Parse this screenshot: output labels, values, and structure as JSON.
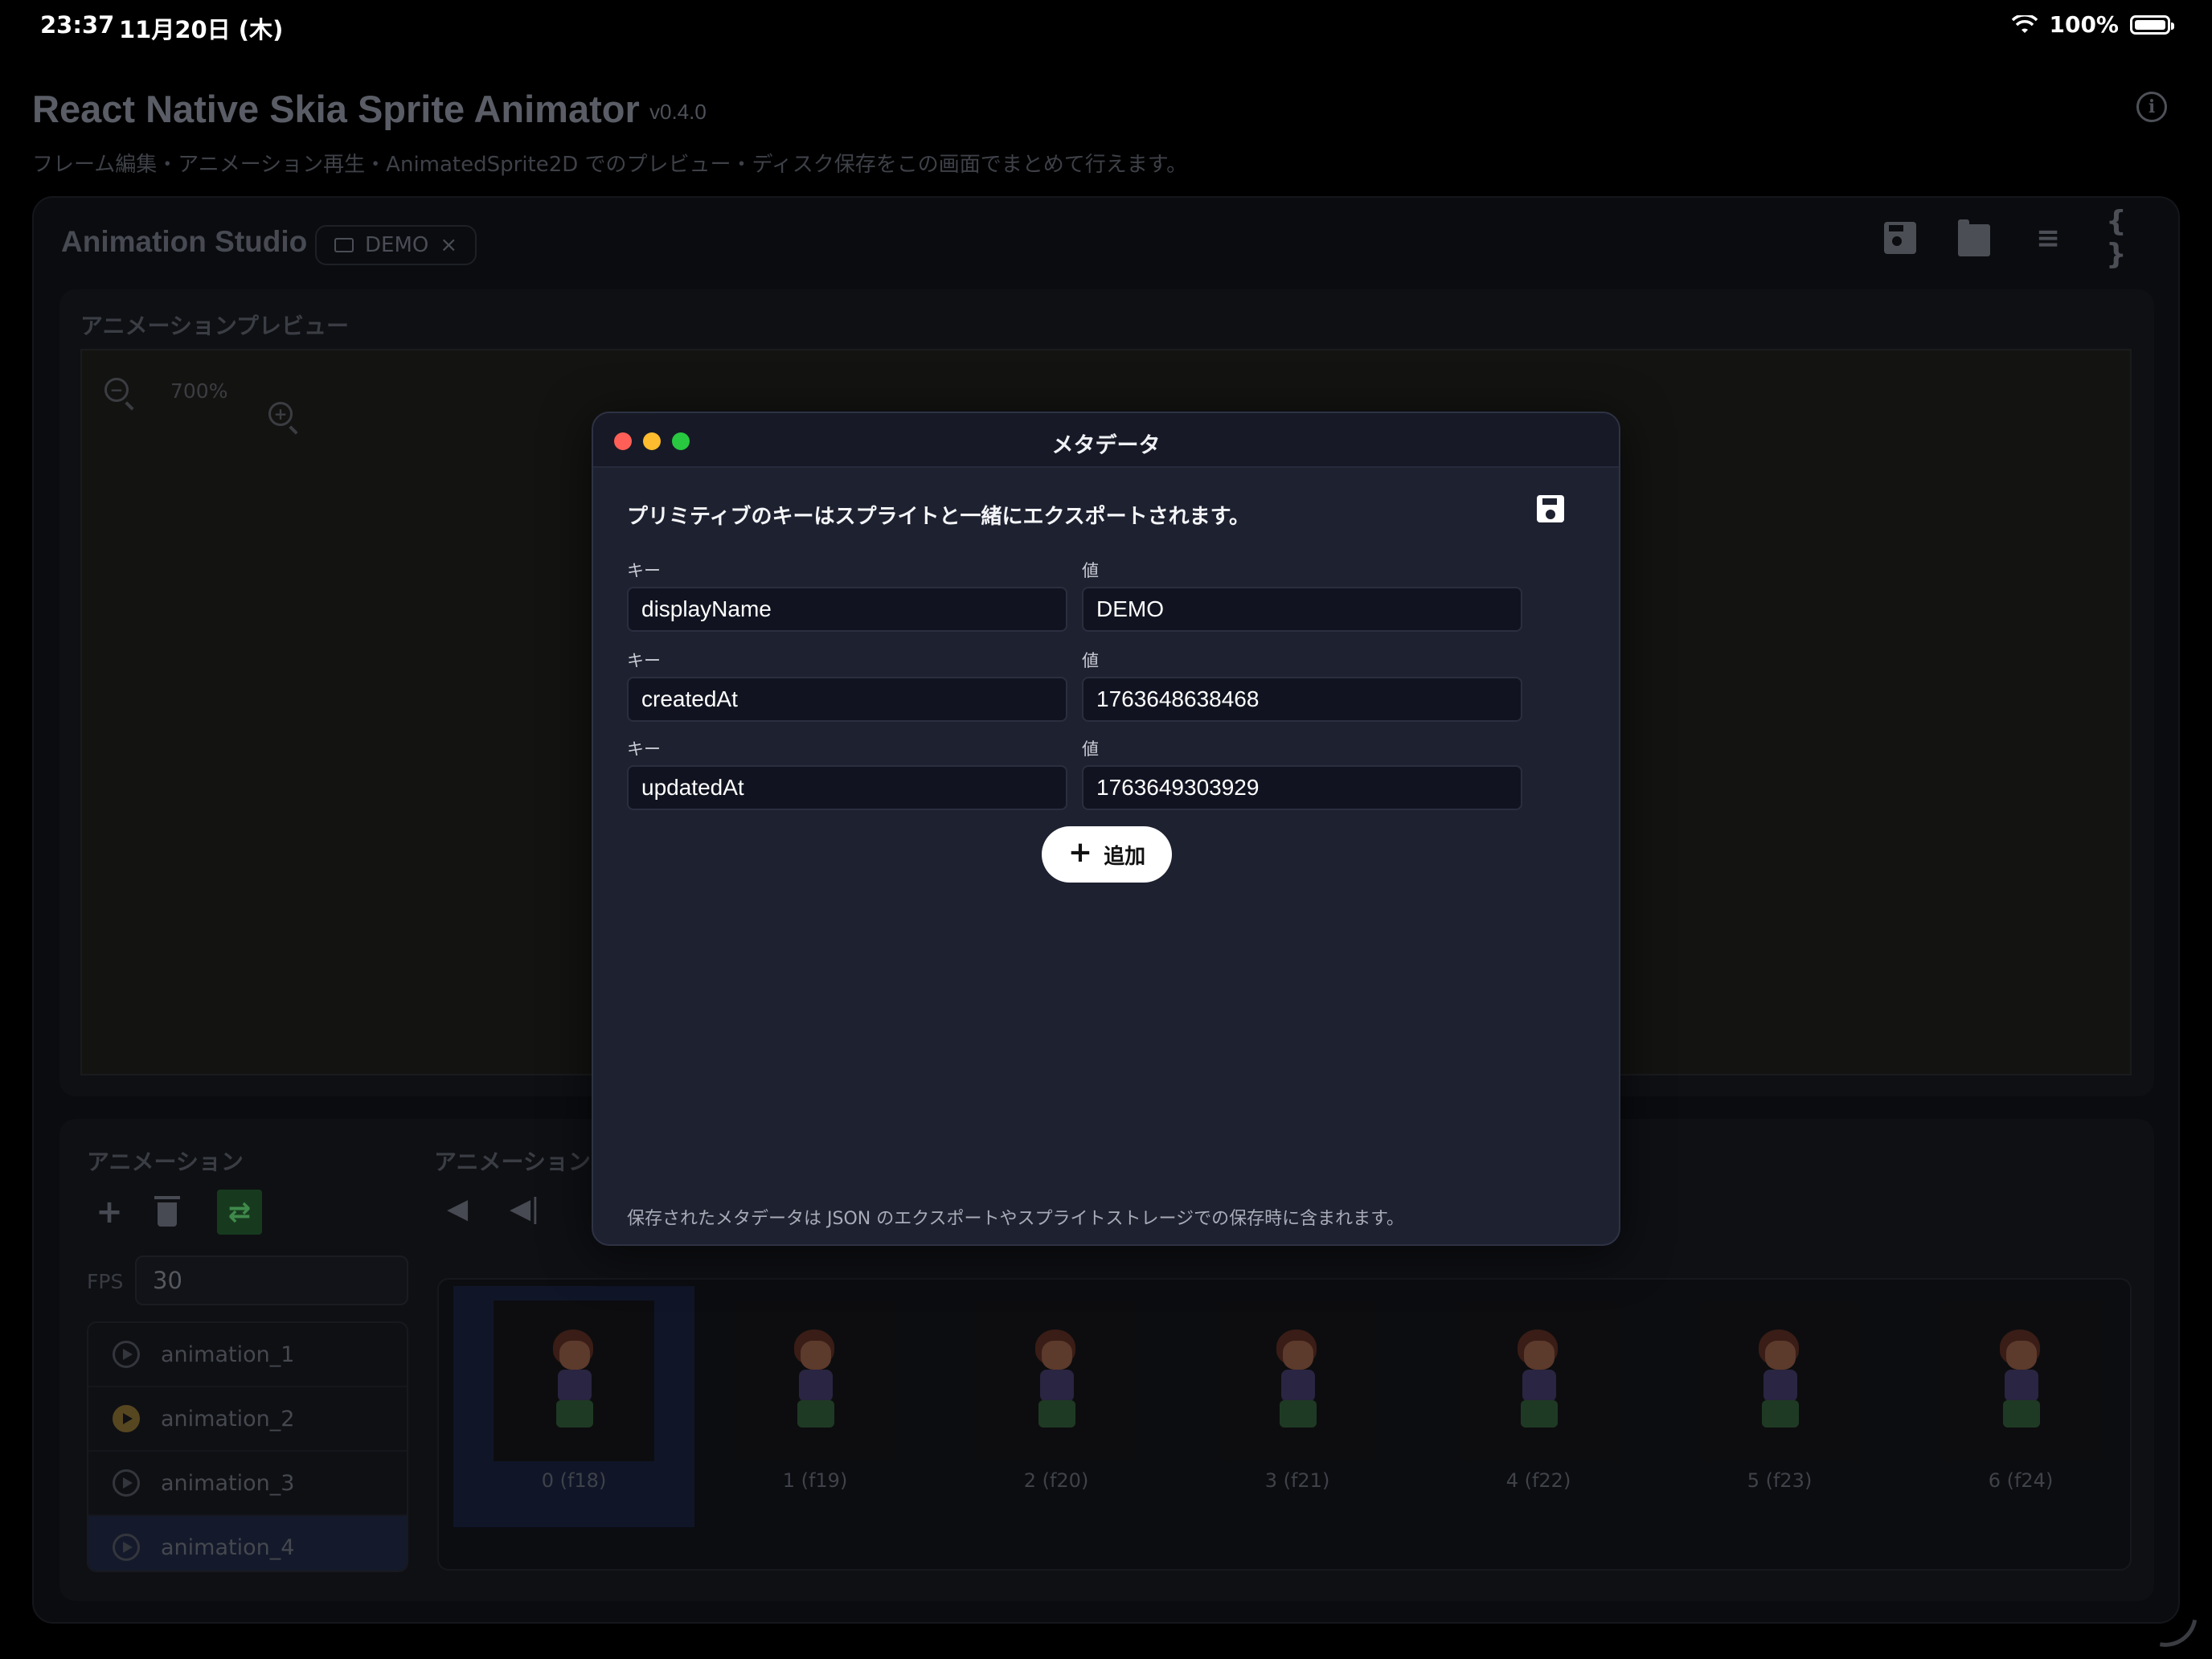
{
  "status_bar": {
    "time": "23:37",
    "date": "11月20日 (木)",
    "battery": "100%"
  },
  "header": {
    "title": "React Native Skia Sprite Animator",
    "version": "v0.4.0",
    "subtitle": "フレーム編集・アニメーション再生・AnimatedSprite2D でのプレビュー・ディスク保存をこの画面でまとめて行えます。",
    "info_icon": "info-icon"
  },
  "studio": {
    "title": "Animation Studio",
    "project_chip": "DEMO",
    "project_chip_close": "×",
    "toolbar_icons": [
      "save-icon",
      "folder-icon",
      "edit-list-icon",
      "braces-icon"
    ],
    "braces_glyph": "{ }",
    "edit_glyph": "≡"
  },
  "preview": {
    "label": "アニメーションプレビュー",
    "zoom_level": "700%",
    "zoom_out_glyph": "−",
    "zoom_in_glyph": "+"
  },
  "animations": {
    "label": "アニメーション",
    "label_2": "アニメーションプ",
    "add_glyph": "+",
    "loop_glyph": "⇄",
    "prev_glyph": "◀",
    "step_back_glyph": "◀|",
    "fps_label": "FPS",
    "fps_value": "30",
    "items": [
      {
        "label": "animation_1",
        "active": false
      },
      {
        "label": "animation_2",
        "active": true
      },
      {
        "label": "animation_3",
        "active": false
      },
      {
        "label": "animation_4",
        "active": false
      }
    ],
    "frames": [
      "0 (f18)",
      "1 (f19)",
      "2 (f20)",
      "3 (f21)",
      "4 (f22)",
      "5 (f23)",
      "6 (f24)"
    ]
  },
  "modal": {
    "title": "メタデータ",
    "description": "プリミティブのキーはスプライトと一緒にエクスポートされます。",
    "key_label": "キー",
    "value_label": "値",
    "rows": [
      {
        "key": "displayName",
        "value": "DEMO"
      },
      {
        "key": "createdAt",
        "value": "1763648638468"
      },
      {
        "key": "updatedAt",
        "value": "1763649303929"
      }
    ],
    "add_button": "追加",
    "add_glyph": "+",
    "footer": "保存されたメタデータは JSON のエクスポートやスプライトストレージでの保存時に含まれます。"
  },
  "colors": {
    "background": "#000000",
    "modal_bg": "#1e2130",
    "modal_titlebar": "#171a26",
    "input_bg": "#111420",
    "traffic_red": "#ff5f57",
    "traffic_yellow": "#febc2e",
    "traffic_green": "#28c840",
    "active_play": "#574720",
    "loop_active": "#173a1f"
  }
}
